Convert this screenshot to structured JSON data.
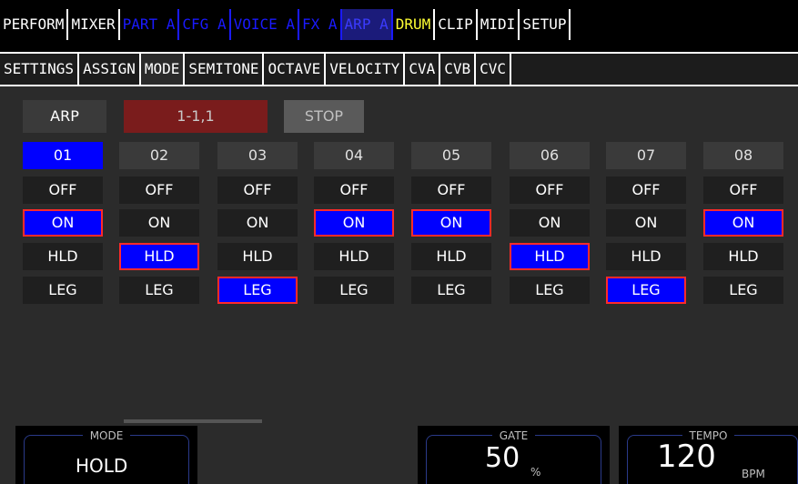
{
  "top_tabs": [
    "PERFORM",
    "MIXER",
    "PART A",
    "CFG A",
    "VOICE A",
    "FX A",
    "ARP A",
    "DRUM",
    "CLIP",
    "MIDI",
    "SETUP"
  ],
  "sub_tabs": [
    "SETTINGS",
    "ASSIGN",
    "MODE",
    "SEMITONE",
    "OCTAVE",
    "VELOCITY",
    "CVA",
    "CVB",
    "CVC"
  ],
  "controls": {
    "arp": "ARP",
    "position": "1-1,1",
    "stop": "STOP"
  },
  "channels": [
    {
      "num": "01",
      "off": "OFF",
      "on": "ON",
      "hld": "HLD",
      "leg": "LEG",
      "selected": "on"
    },
    {
      "num": "02",
      "off": "OFF",
      "on": "ON",
      "hld": "HLD",
      "leg": "LEG",
      "selected": "hld"
    },
    {
      "num": "03",
      "off": "OFF",
      "on": "ON",
      "hld": "HLD",
      "leg": "LEG",
      "selected": "leg"
    },
    {
      "num": "04",
      "off": "OFF",
      "on": "ON",
      "hld": "HLD",
      "leg": "LEG",
      "selected": "on"
    },
    {
      "num": "05",
      "off": "OFF",
      "on": "ON",
      "hld": "HLD",
      "leg": "LEG",
      "selected": "on"
    },
    {
      "num": "06",
      "off": "OFF",
      "on": "ON",
      "hld": "HLD",
      "leg": "LEG",
      "selected": "hld"
    },
    {
      "num": "07",
      "off": "OFF",
      "on": "ON",
      "hld": "HLD",
      "leg": "LEG",
      "selected": "leg"
    },
    {
      "num": "08",
      "off": "OFF",
      "on": "ON",
      "hld": "HLD",
      "leg": "LEG",
      "selected": "on"
    }
  ],
  "encoders": {
    "mode": {
      "label": "MODE",
      "value": "HOLD"
    },
    "gate": {
      "label": "GATE",
      "value": "50",
      "unit": "%"
    },
    "tempo": {
      "label": "TEMPO",
      "value": "120",
      "unit": "BPM"
    }
  },
  "colors": {
    "selected_fill": "#0000ff",
    "selected_border": "#ff2a2a",
    "yellow_tab": "#ffff33",
    "position_bg": "#7a1c1c"
  }
}
